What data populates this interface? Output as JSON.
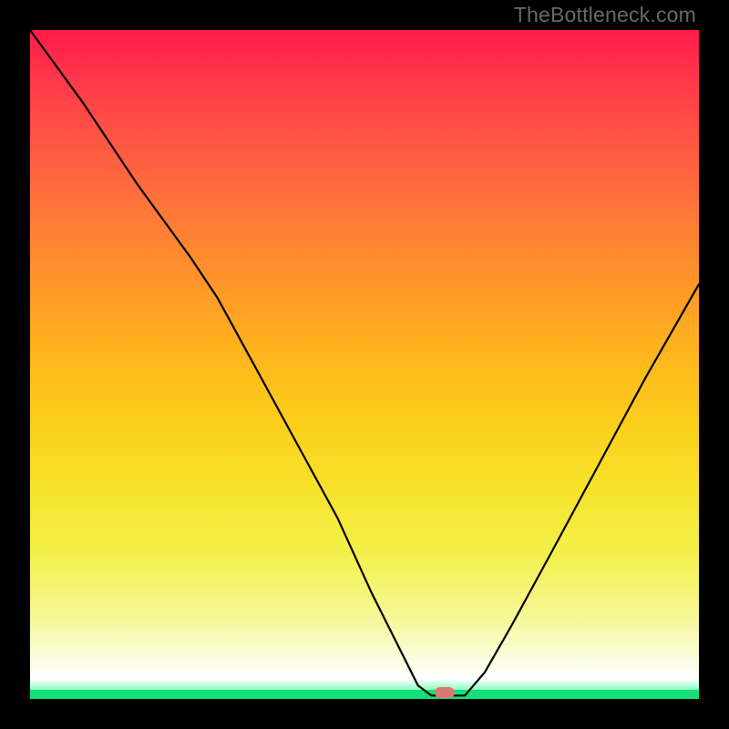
{
  "watermark": "TheBottleneck.com",
  "chart_data": {
    "type": "line",
    "title": "",
    "xlabel": "",
    "ylabel": "",
    "xlim": [
      0,
      100
    ],
    "ylim": [
      0,
      100
    ],
    "series": [
      {
        "name": "bottleneck-curve",
        "x": [
          0,
          8,
          16,
          24,
          28,
          34,
          40,
          46,
          51,
          55,
          58,
          60,
          62,
          65,
          68,
          72,
          78,
          85,
          92,
          100
        ],
        "values": [
          100,
          89,
          77,
          66,
          60,
          49,
          38,
          27,
          16,
          8,
          2,
          0.5,
          0.5,
          0.5,
          4,
          11,
          22,
          35,
          48,
          62
        ]
      }
    ],
    "marker": {
      "x": 62,
      "y": 0.9
    },
    "gradient": {
      "top_color": "#ff1a4a",
      "mid_color": "#fccd1a",
      "bottom_color": "#14e07a"
    }
  }
}
